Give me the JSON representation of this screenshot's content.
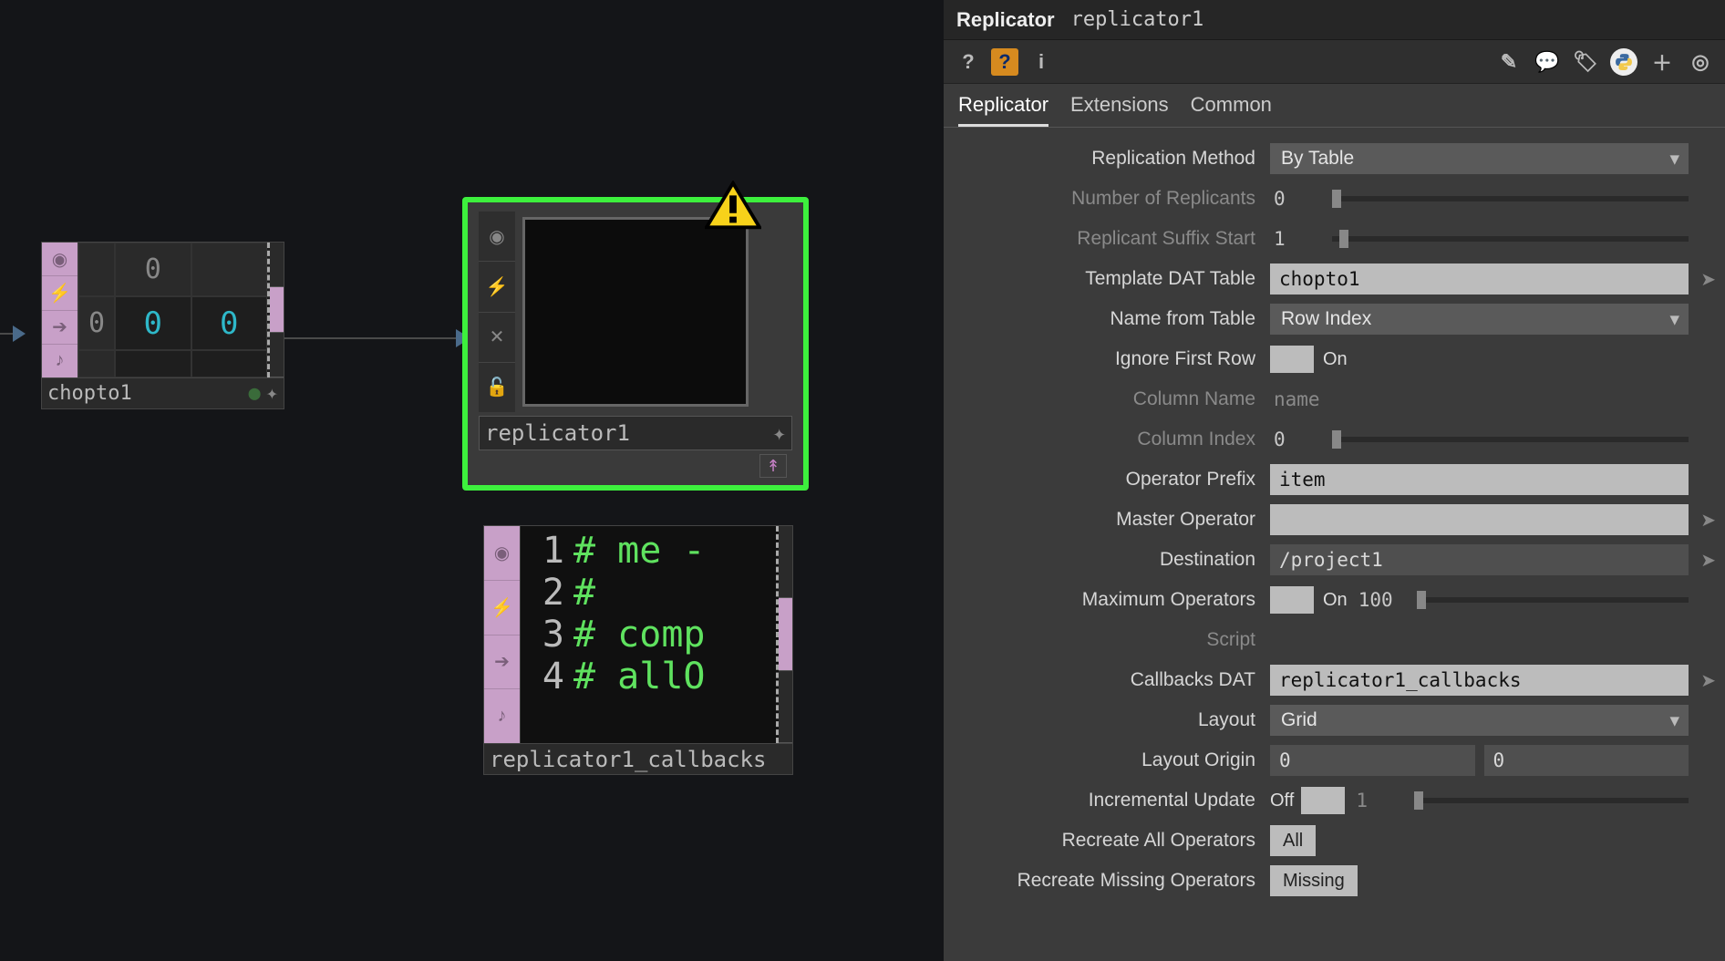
{
  "network": {
    "chopto": {
      "name": "chopto1",
      "header_val": "0",
      "cells": [
        "0",
        "0",
        "0"
      ],
      "gutter_icons": [
        "record",
        "bolt",
        "arrow",
        "note"
      ]
    },
    "replicator": {
      "name": "replicator1",
      "gutter_icons": [
        "record",
        "bolt",
        "close",
        "unlock"
      ],
      "warning": true
    },
    "callbacks": {
      "name": "replicator1_callbacks",
      "gutter_icons": [
        "record",
        "bolt",
        "arrow",
        "note"
      ],
      "lines": [
        "# me -",
        "#",
        "# comp",
        "# allO"
      ]
    }
  },
  "params": {
    "header": {
      "type": "Replicator",
      "name": "replicator1"
    },
    "tabs": [
      "Replicator",
      "Extensions",
      "Common"
    ],
    "active_tab": 0,
    "rows": {
      "replication_method": {
        "label": "Replication Method",
        "value": "By Table"
      },
      "num_replicants": {
        "label": "Number of Replicants",
        "value": "0"
      },
      "suffix_start": {
        "label": "Replicant Suffix Start",
        "value": "1"
      },
      "template_dat": {
        "label": "Template DAT Table",
        "value": "chopto1"
      },
      "name_from_table": {
        "label": "Name from Table",
        "value": "Row Index"
      },
      "ignore_first_row": {
        "label": "Ignore First Row",
        "value": "On"
      },
      "column_name": {
        "label": "Column Name",
        "value": "name"
      },
      "column_index": {
        "label": "Column Index",
        "value": "0"
      },
      "operator_prefix": {
        "label": "Operator Prefix",
        "value": "item"
      },
      "master_operator": {
        "label": "Master Operator",
        "value": ""
      },
      "destination": {
        "label": "Destination",
        "value": "/project1"
      },
      "max_operators": {
        "label": "Maximum Operators",
        "toggle": "On",
        "value": "100"
      },
      "script": {
        "label": "Script"
      },
      "callbacks_dat": {
        "label": "Callbacks DAT",
        "value": "replicator1_callbacks"
      },
      "layout": {
        "label": "Layout",
        "value": "Grid"
      },
      "layout_origin": {
        "label": "Layout Origin",
        "x": "0",
        "y": "0"
      },
      "incremental": {
        "label": "Incremental Update",
        "toggle": "Off",
        "value": "1"
      },
      "recreate_all": {
        "label": "Recreate All Operators",
        "button": "All"
      },
      "recreate_missing": {
        "label": "Recreate Missing Operators",
        "button": "Missing"
      }
    }
  }
}
